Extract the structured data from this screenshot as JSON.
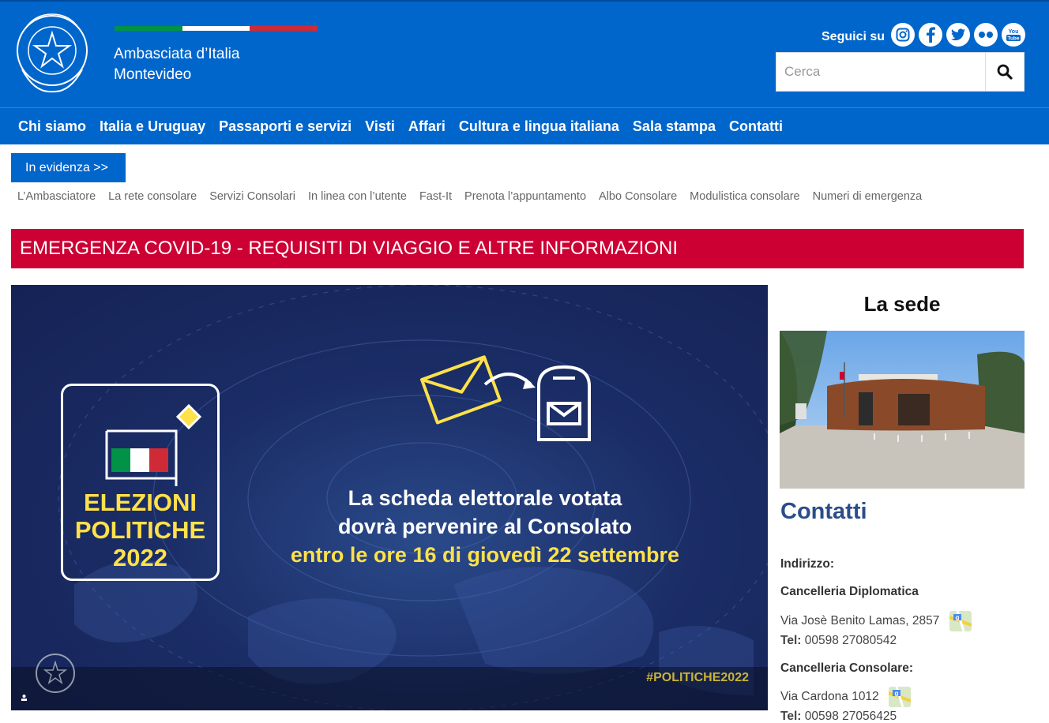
{
  "header": {
    "brand_line1": "Ambasciata d’Italia",
    "brand_line2": "Montevideo",
    "follow_label": "Seguici su",
    "socials": [
      {
        "name": "instagram-icon",
        "glyph": "◎"
      },
      {
        "name": "facebook-icon",
        "glyph": "f"
      },
      {
        "name": "twitter-icon",
        "glyph": "t"
      },
      {
        "name": "flickr-icon",
        "glyph": "●●"
      },
      {
        "name": "youtube-icon",
        "glyph": "You Tube"
      }
    ],
    "search_placeholder": "Cerca",
    "colors": {
      "blue": "#0066cc",
      "flag_green": "#009246",
      "flag_white": "#ffffff",
      "flag_red": "#ce2b37"
    }
  },
  "nav": [
    "Chi siamo",
    "Italia e Uruguay",
    "Passaporti e servizi",
    "Visti",
    "Affari",
    "Cultura e lingua italiana",
    "Sala stampa",
    "Contatti"
  ],
  "evidenza": {
    "button": "In evidenza >>",
    "links": [
      "L’Ambasciatore",
      "La rete consolare",
      "Servizi Consolari",
      "In linea con l’utente",
      "Fast-It",
      "Prenota l’appuntamento",
      "Albo Consolare",
      "Modulistica consolare",
      "Numeri di emergenza"
    ]
  },
  "covid_banner": "EMERGENZA COVID-19 - REQUISITI DI VIAGGIO E ALTRE INFORMAZIONI",
  "hero": {
    "elezioni_line1": "ELEZIONI",
    "elezioni_line2": "POLITICHE",
    "elezioni_line3": "2022",
    "msg_line1": "La scheda elettorale votata",
    "msg_line2": "dovrà pervenire al Consolato",
    "msg_line3": "entro le ore 16 di giovedì 22 settembre",
    "hashtag": "#POLITICHE2022"
  },
  "sidebar": {
    "sede_title": "La sede",
    "contatti_title": "Contatti",
    "indirizzo_label": "Indirizzo:",
    "cancelleria_diplomatica": "Cancelleria Diplomatica",
    "address1": "Via Josè Benito Lamas, 2857",
    "tel_label": "Tel:",
    "tel1": "00598 27080542",
    "cancelleria_consolare": "Cancelleria Consolare:",
    "address2": "Via Cardona 1012",
    "tel2": "00598 27056425"
  }
}
